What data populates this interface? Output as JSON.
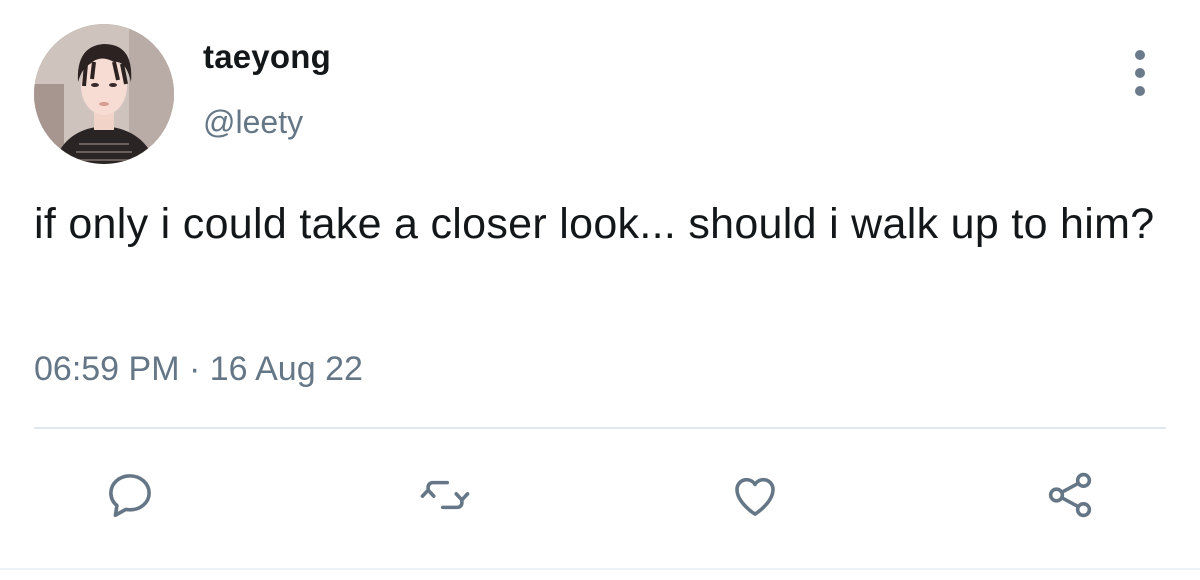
{
  "tweet": {
    "author": {
      "display_name": "taeyong",
      "handle": "@leety"
    },
    "text": "if only i could take a closer look... should i walk up to him?",
    "timestamp": "06:59 PM · 16 Aug 22",
    "actions": {
      "reply_icon": "reply-icon",
      "retweet_icon": "retweet-icon",
      "like_icon": "heart-icon",
      "share_icon": "share-icon",
      "more_icon": "more-vertical-icon"
    },
    "colors": {
      "text_primary": "#14171a",
      "text_secondary": "#657786",
      "icon": "#657786",
      "divider": "#e1e8ed"
    }
  }
}
